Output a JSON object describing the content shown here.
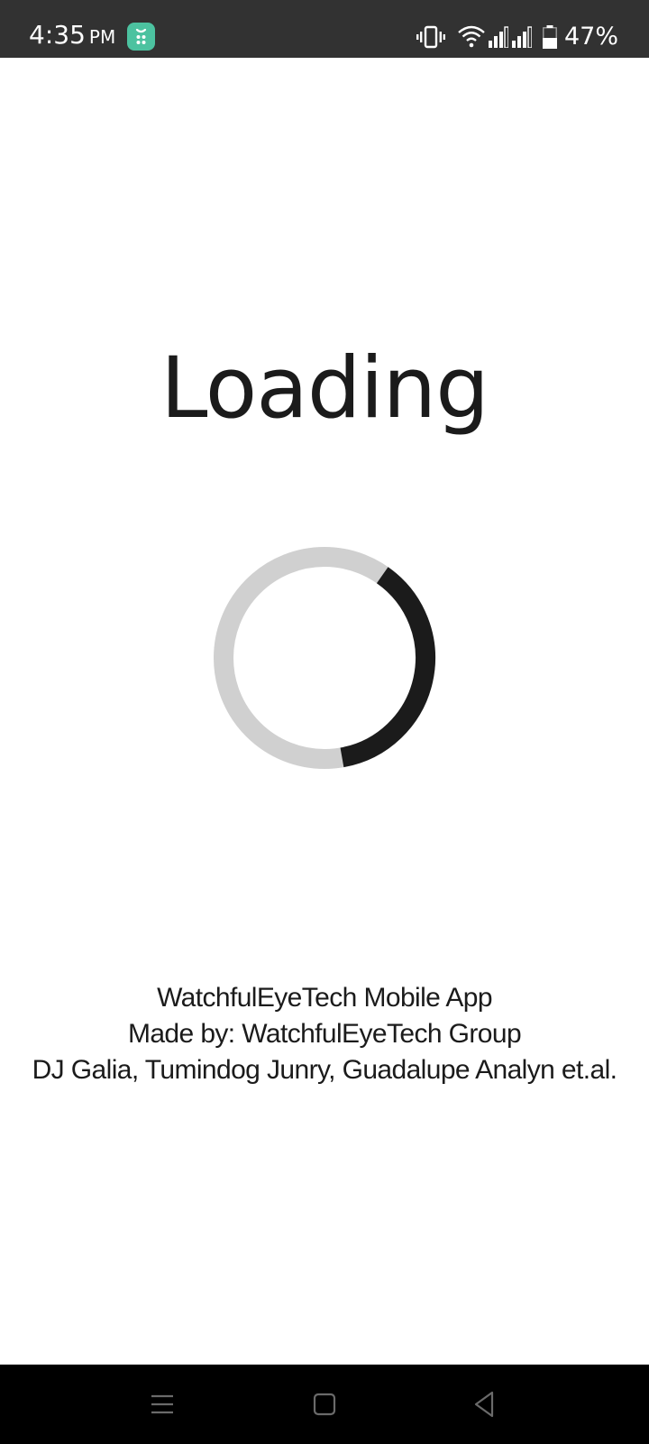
{
  "status_bar": {
    "time": "4:35",
    "ampm": "PM",
    "battery_percent": "47%",
    "app_icon": "app-notification-icon",
    "background": "#323232"
  },
  "main": {
    "loading_label": "Loading",
    "spinner": {
      "track_color": "#d0d0d0",
      "arc_color": "#1b1b1b"
    },
    "credits": [
      "WatchfulEyeTech Mobile App",
      "Made by: WatchfulEyeTech Group",
      "DJ Galia, Tumindog Junry, Guadalupe Analyn et.al."
    ]
  },
  "nav_bar": {
    "buttons": [
      "menu-icon",
      "home-icon",
      "back-icon"
    ]
  }
}
